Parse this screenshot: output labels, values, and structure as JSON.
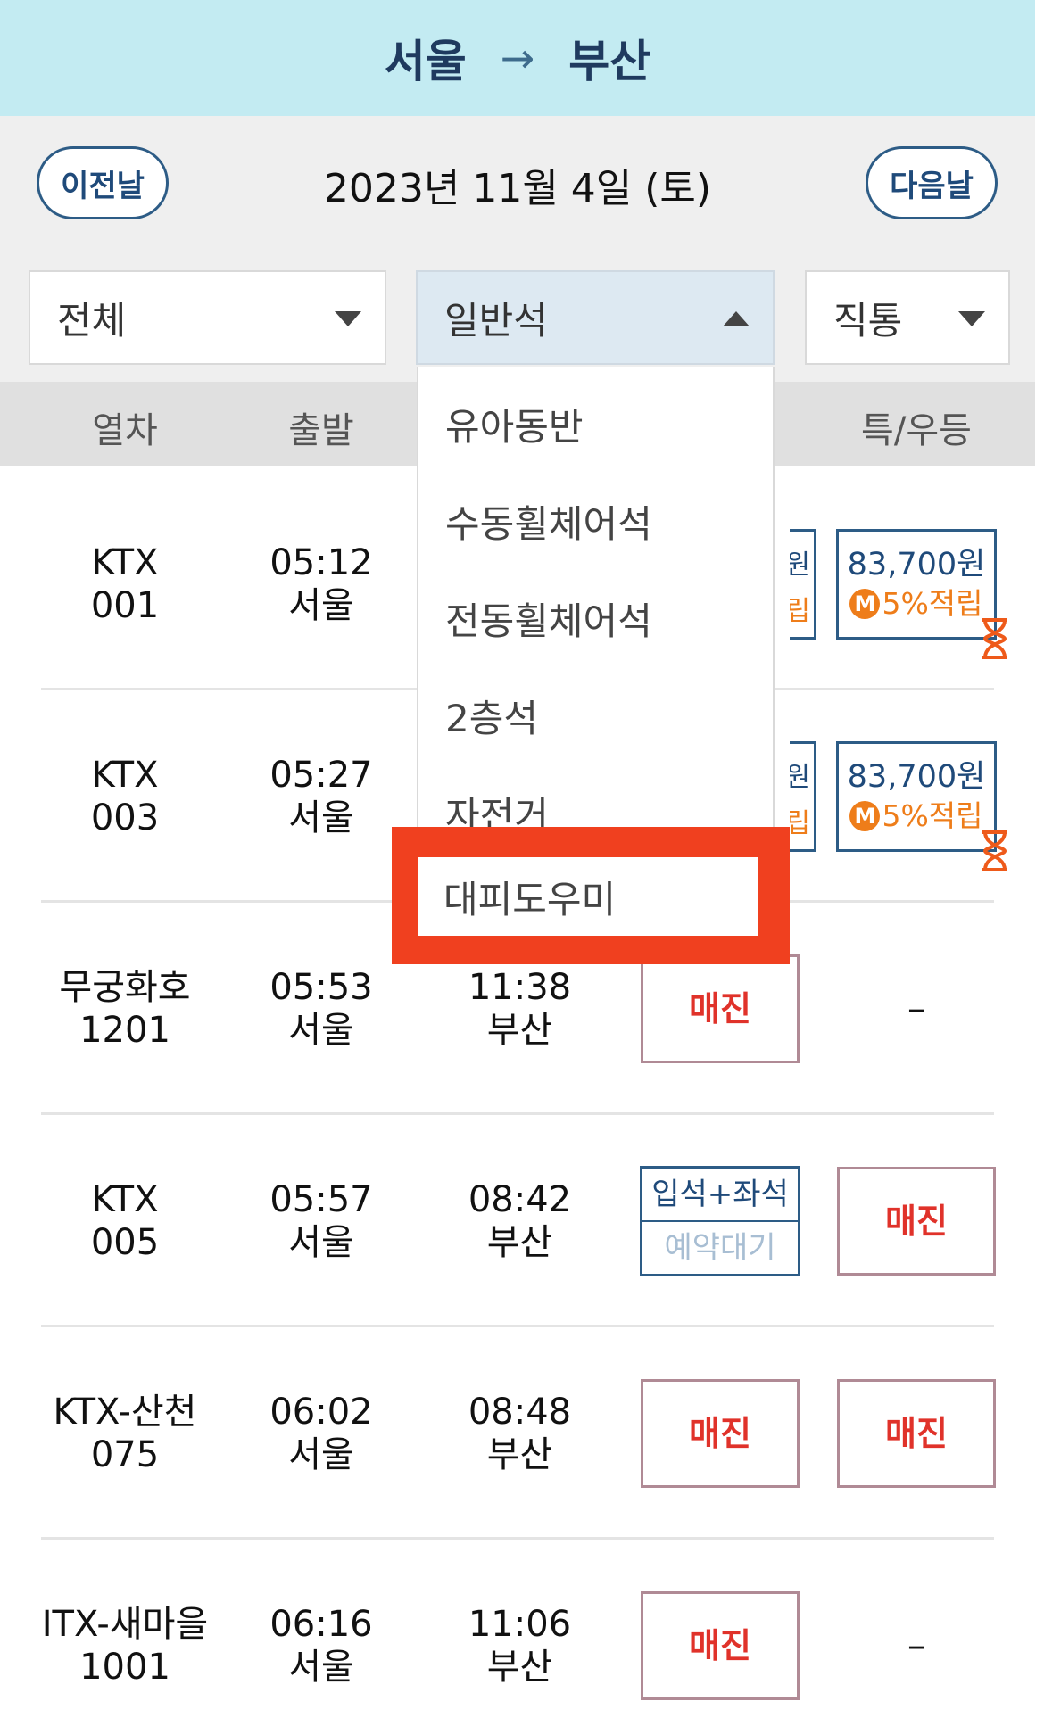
{
  "header": {
    "from": "서울",
    "arrow": "→",
    "to": "부산"
  },
  "datebar": {
    "prev_label": "이전날",
    "date": "2023년 11월 4일 (토)",
    "next_label": "다음날"
  },
  "filters": {
    "type": {
      "selected": "전체"
    },
    "class": {
      "selected": "일반석"
    },
    "route": {
      "selected": "직통"
    }
  },
  "dropdown": {
    "options": [
      "유아동반",
      "수동휠체어석",
      "전동휠체어석",
      "2층석",
      "자전거",
      "대피도우미"
    ],
    "highlight_color": "#f0401f"
  },
  "columns": {
    "train": "열차",
    "departure": "출발",
    "special": "특/우등"
  },
  "trains": [
    {
      "name": "KTX",
      "number": "001",
      "dep_time": "05:12",
      "dep_station": "서울",
      "special": {
        "price": "83,700원",
        "mileage_badge": "M",
        "mileage": "5%적립"
      },
      "general_partial": {
        "top": "원",
        "bottom": "립"
      }
    },
    {
      "name": "KTX",
      "number": "003",
      "dep_time": "05:27",
      "dep_station": "서울",
      "special": {
        "price": "83,700원",
        "mileage_badge": "M",
        "mileage": "5%적립"
      },
      "general_partial": {
        "top": "원",
        "bottom": "립"
      }
    },
    {
      "name": "무궁화호",
      "number": "1201",
      "dep_time": "05:53",
      "dep_station": "서울",
      "arr_time": "11:38",
      "arr_station": "부산",
      "general": "매진",
      "special": "–"
    },
    {
      "name": "KTX",
      "number": "005",
      "dep_time": "05:57",
      "dep_station": "서울",
      "arr_time": "08:42",
      "arr_station": "부산",
      "general_top": "입석+좌석",
      "general_bottom": "예약대기",
      "special": "매진"
    },
    {
      "name": "KTX-산천",
      "number": "075",
      "dep_time": "06:02",
      "dep_station": "서울",
      "arr_time": "08:48",
      "arr_station": "부산",
      "general": "매진",
      "special": "매진"
    },
    {
      "name": "ITX-새마을",
      "number": "1001",
      "dep_time": "06:16",
      "dep_station": "서울",
      "arr_time": "11:06",
      "arr_station": "부산",
      "general": "매진",
      "special": "–"
    }
  ],
  "colors": {
    "header_bg": "#c3ebf2",
    "accent_blue": "#2d5c86",
    "soldout_red": "#e0322a",
    "mileage_orange": "#ee7d1a"
  }
}
